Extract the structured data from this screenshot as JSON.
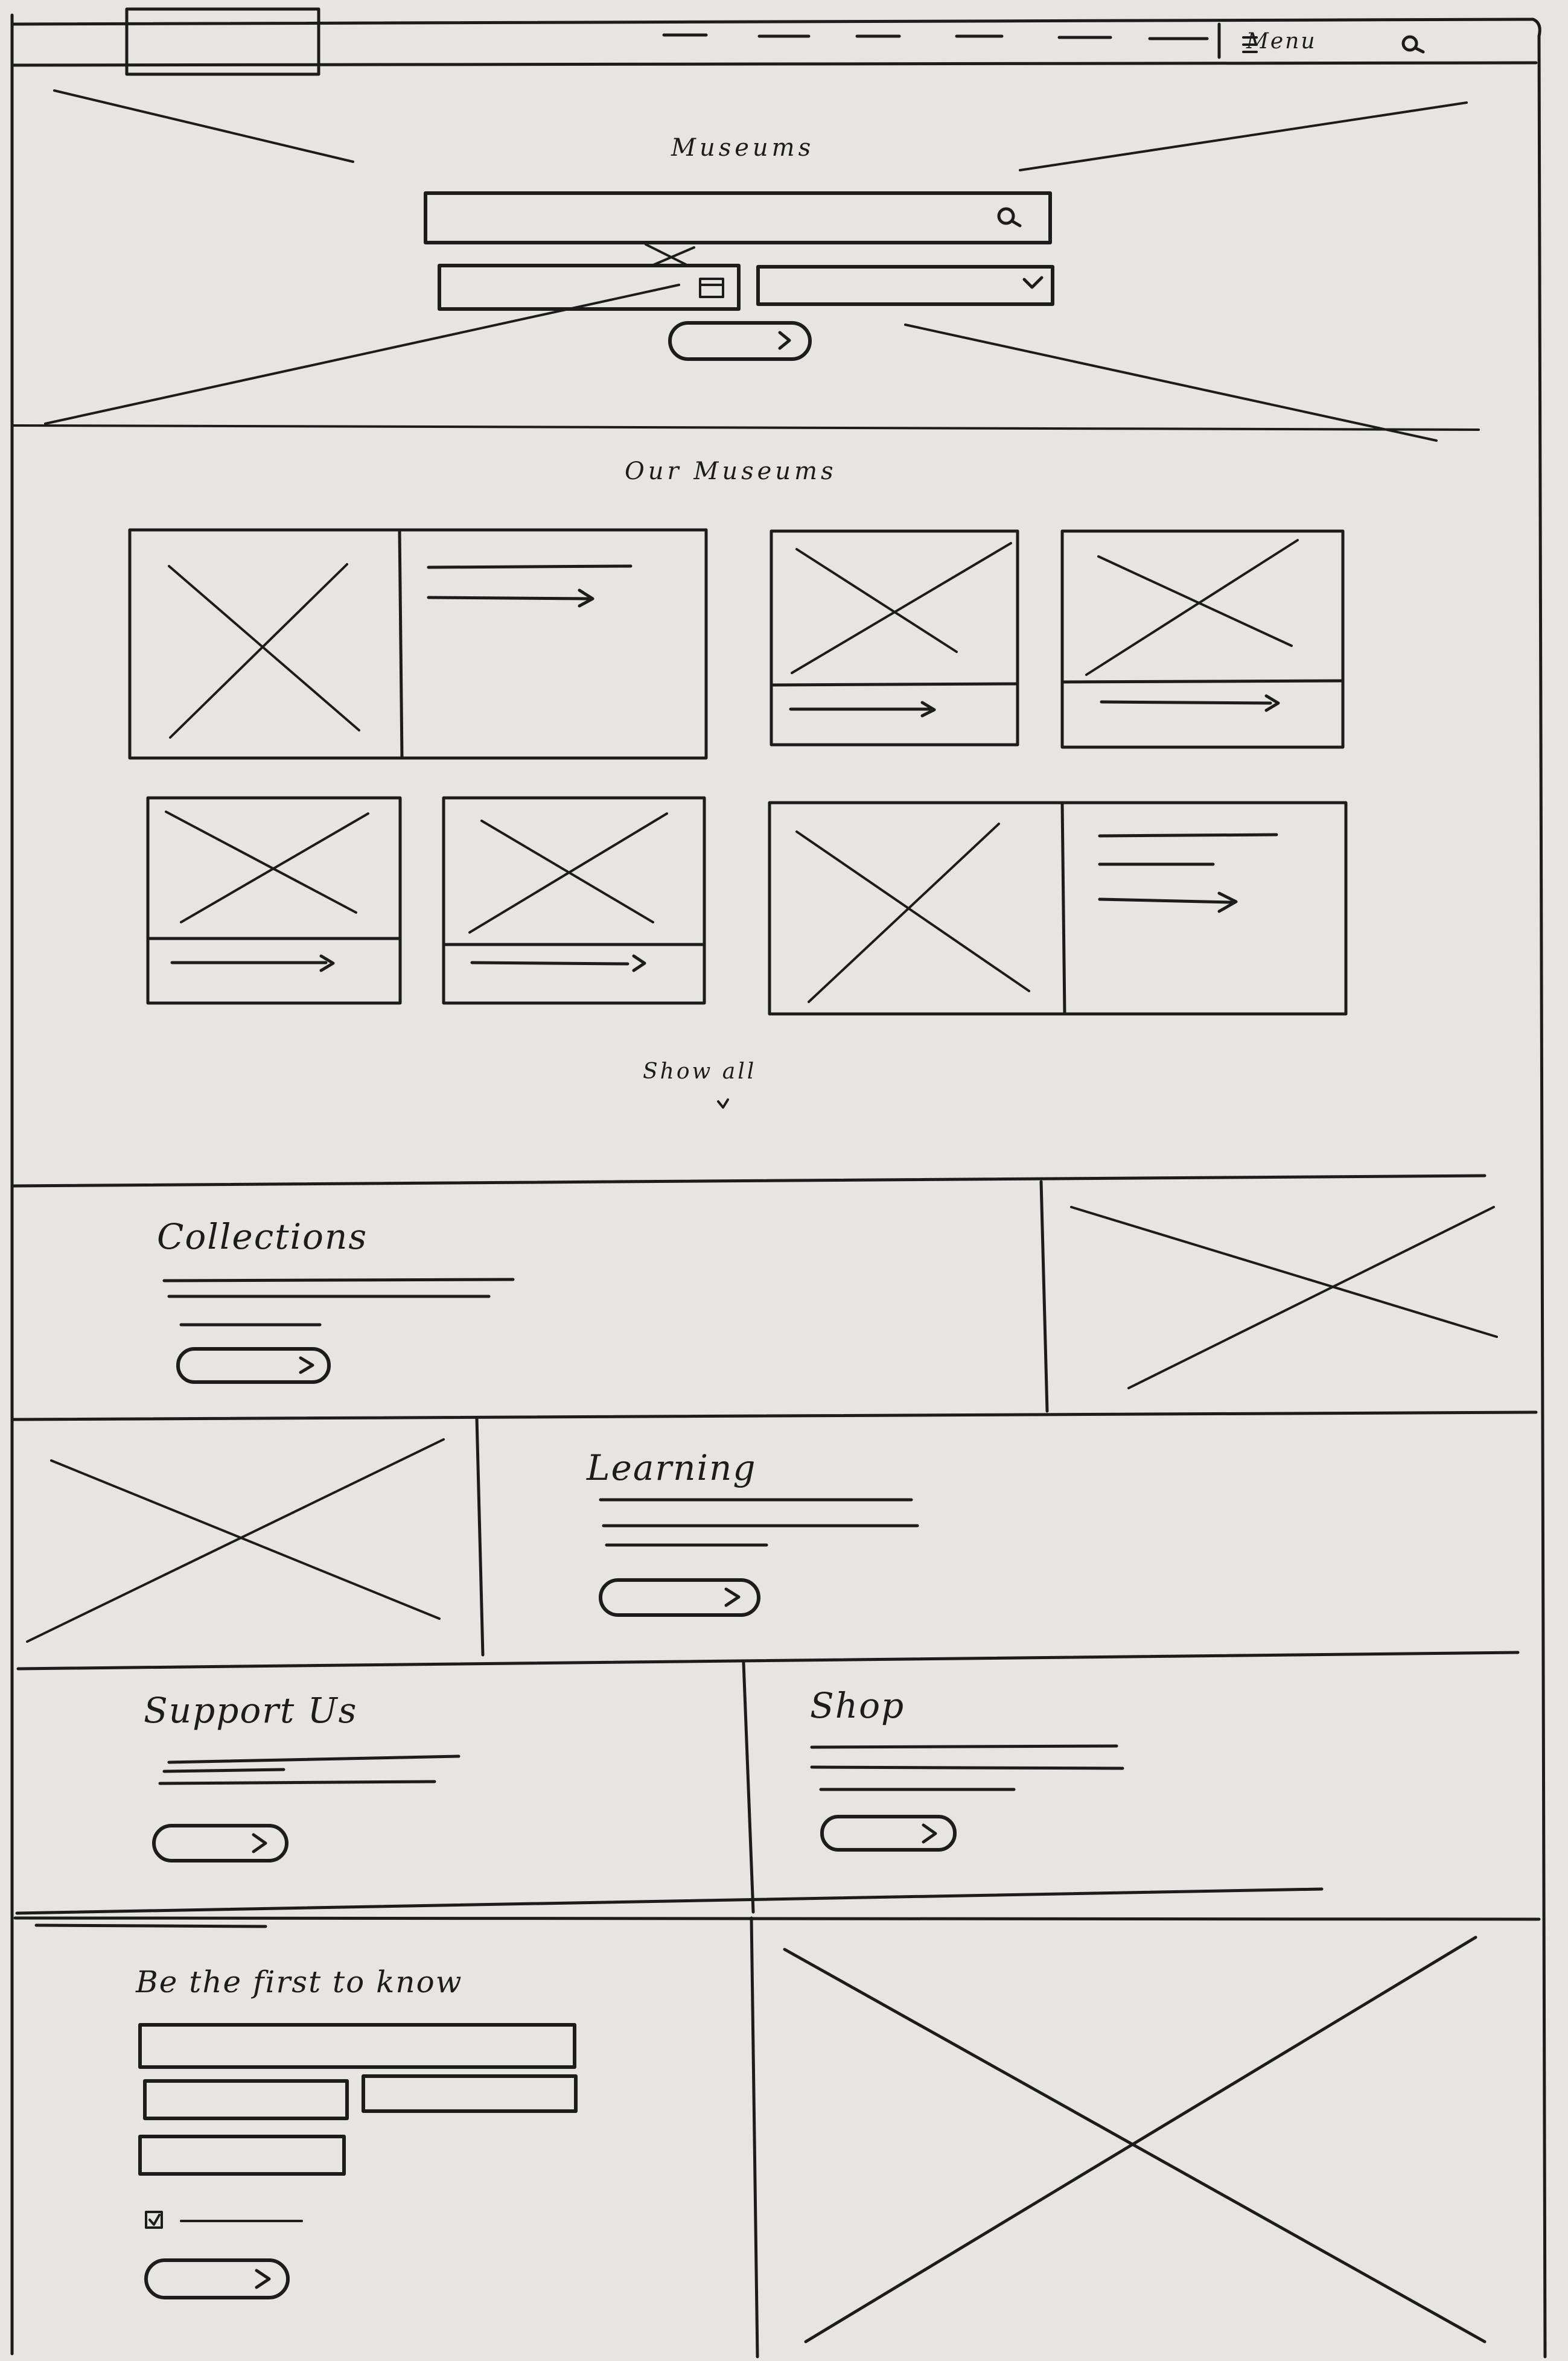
{
  "header": {
    "menu_label": "Menu",
    "menu_icon": "hamburger-icon",
    "search_icon": "search-icon"
  },
  "hero": {
    "title": "Museums",
    "search_icon": "search-icon",
    "date_icon": "calendar-icon",
    "select_icon": "chevron-down-icon",
    "button_icon": "chevron-right-icon"
  },
  "museums": {
    "title": "Our Museums",
    "show_all_label": "Show all",
    "show_all_icon": "chevron-down-icon"
  },
  "collections": {
    "title": "Collections"
  },
  "learning": {
    "title": "Learning"
  },
  "support": {
    "title": "Support Us"
  },
  "shop": {
    "title": "Shop"
  },
  "newsletter": {
    "title": "Be the first to know"
  }
}
